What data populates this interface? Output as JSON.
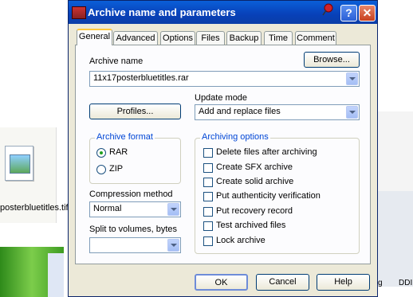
{
  "background": {
    "file_name": "posterbluetitles.tif",
    "right_text_1": "g",
    "right_text_2": "DDI"
  },
  "dialog": {
    "title": "Archive name and parameters",
    "help_glyph": "?",
    "close_glyph": "✕"
  },
  "tabs": [
    "General",
    "Advanced",
    "Options",
    "Files",
    "Backup",
    "Time",
    "Comment"
  ],
  "general": {
    "archive_name_label": "Archive name",
    "browse_label": "Browse...",
    "archive_name_value": "11x17posterbluetitles.rar",
    "profiles_label": "Profiles...",
    "update_mode_label": "Update mode",
    "update_mode_value": "Add and replace files",
    "archive_format_label": "Archive format",
    "format_rar": "RAR",
    "format_zip": "ZIP",
    "selected_format": "RAR",
    "compression_label": "Compression method",
    "compression_value": "Normal",
    "split_label": "Split to volumes, bytes",
    "split_value": "",
    "archiving_options_label": "Archiving options",
    "options": [
      "Delete files after archiving",
      "Create SFX archive",
      "Create solid archive",
      "Put authenticity verification",
      "Put recovery record",
      "Test archived files",
      "Lock archive"
    ]
  },
  "footer": {
    "ok_label": "OK",
    "cancel_label": "Cancel",
    "help_label": "Help"
  },
  "icons": {
    "app": "winrar-icon",
    "pin": "pin-icon",
    "file": "image-file-icon"
  }
}
